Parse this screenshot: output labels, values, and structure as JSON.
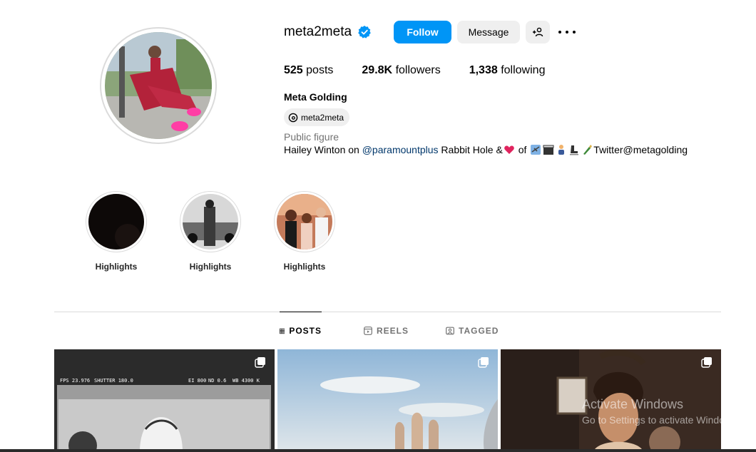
{
  "profile": {
    "username": "meta2meta",
    "follow_label": "Follow",
    "message_label": "Message",
    "stats": {
      "posts": "525",
      "posts_label": "posts",
      "followers": "29.8K",
      "followers_label": "followers",
      "following": "1,338",
      "following_label": "following"
    },
    "full_name": "Meta Golding",
    "threads_handle": "meta2meta",
    "category": "Public figure",
    "bio": {
      "prefix": "Hailey Winton on ",
      "mention": "@paramountplus",
      "middle": " Rabbit Hole &",
      "of": " of ",
      "suffix": "Twitter@metagolding"
    }
  },
  "highlights": [
    {
      "label": "Highlights"
    },
    {
      "label": "Highlights"
    },
    {
      "label": "Highlights"
    }
  ],
  "tabs": [
    {
      "label": "POSTS",
      "active": true
    },
    {
      "label": "REELS",
      "active": false
    },
    {
      "label": "TAGGED",
      "active": false
    }
  ],
  "posts": [
    {
      "overlay_text": {
        "fps": "FPS 23.976",
        "shutter": "SHUTTER 180.0",
        "ei": "EI 800",
        "nd": "ND 0.6",
        "wb": "WB 4300 K"
      }
    },
    {},
    {}
  ],
  "watermark": {
    "line1": "Activate Windows",
    "line2": "Go to Settings to activate Windows."
  },
  "colors": {
    "accent": "#0095f6",
    "verified": "#0095f6",
    "mention": "#00376b"
  }
}
